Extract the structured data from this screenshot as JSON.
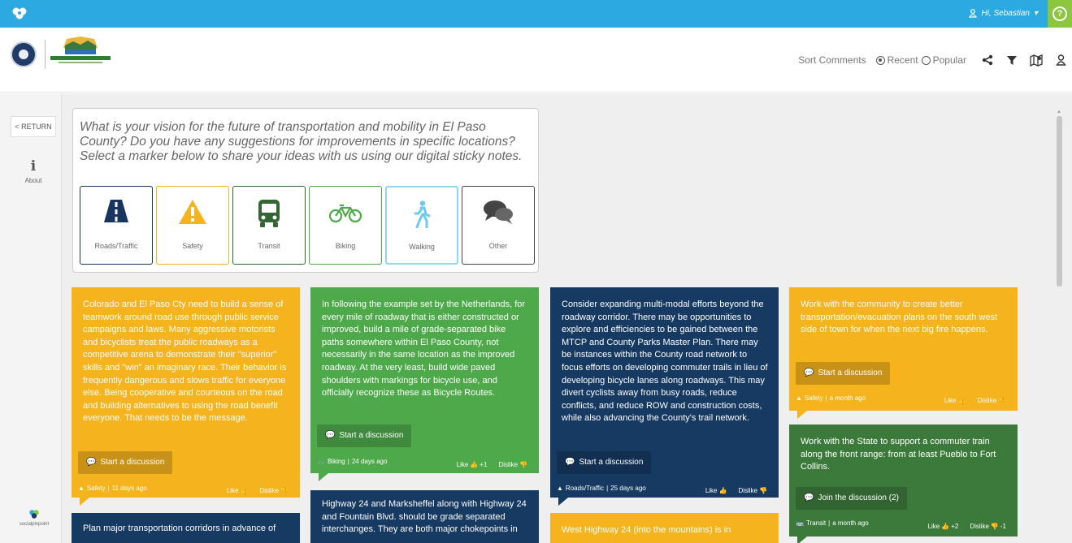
{
  "topbar": {
    "brand_icon": "socialpinpoint-logo-icon",
    "user_label": "Hi, Sebastian",
    "help_label": "?",
    "colors": {
      "bar": "#2ba9e0",
      "help": "#8cc63f"
    }
  },
  "header": {
    "sort_label": "Sort Comments",
    "sort_options": [
      "Recent",
      "Popular"
    ],
    "sort_selected": "Recent",
    "tools": [
      "share-icon",
      "filter-icon",
      "map-icon",
      "user-icon"
    ]
  },
  "sidebar": {
    "return_label": "< RETURN",
    "about_label": "About",
    "brand_label": "socialpinpoint"
  },
  "prompt": {
    "question": "What is your vision for the future of transportation and mobility in El Paso County? Do you have any suggestions for improvements in specific locations? Select a marker below to share your ideas with us using our digital sticky notes.",
    "categories": [
      {
        "label": "Roads/Traffic",
        "icon": "road-icon",
        "color": "#17355e"
      },
      {
        "label": "Safety",
        "icon": "warning-icon",
        "color": "#f5b31e"
      },
      {
        "label": "Transit",
        "icon": "bus-icon",
        "color": "#336633"
      },
      {
        "label": "Biking",
        "icon": "bicycle-icon",
        "color": "#4ea94a"
      },
      {
        "label": "Walking",
        "icon": "pedestrian-icon",
        "color": "#6fc9ea"
      },
      {
        "label": "Other",
        "icon": "speech-bubbles-icon",
        "color": "#444444"
      }
    ]
  },
  "notes": [
    {
      "text": "Colorado and El Paso Cty need to build a sense of teamwork around road use through public service campaigns and laws. Many aggressive motorists and bicyclists treat the public roadways as a competitive arena to demonstrate their \"superior\" skills and \"win\" an imaginary race. Their behavior is frequently dangerous and slows traffic for everyone else. Being cooperative and courteous on the road and building alternatives to using the road benefit everyone. That needs to be the message.",
      "action": "Start a discussion",
      "category": "Safety",
      "age": "11 days ago",
      "like": "Like",
      "dislike": "Dislike"
    },
    {
      "text": "In following the example set by the Netherlands, for every mile of roadway that is either constructed or improved, build a mile of grade-separated bike paths somewhere within El Paso County, not necessarily in the same location as the improved roadway. At the very least, build wide paved shoulders with markings for bicycle use, and officially recognize these as Bicycle Routes.",
      "action": "Start a discussion",
      "category": "Biking",
      "age": "24 days ago",
      "like": "Like",
      "like_count": "+1",
      "dislike": "Dislike"
    },
    {
      "text": "Consider expanding multi-modal efforts beyond the roadway corridor. There may be opportunities to explore and efficiencies to be gained between the MTCP and County Parks Master Plan. There may be instances within the County road network to focus efforts on developing commuter trails in lieu of developing bicycle lanes along roadways. This may divert cyclists away from busy roads, reduce conflicts, and reduce ROW and construction costs, while also advancing the County's trail network.",
      "action": "Start a discussion",
      "category": "Roads/Traffic",
      "age": "25 days ago",
      "like": "Like",
      "dislike": "Dislike"
    },
    {
      "text": "Work with the community to create better transportation/evacuation plans on the south west side of town for when the next big fire happens.",
      "action": "Start a discussion",
      "category": "Safety",
      "age": "a month ago",
      "like": "Like",
      "dislike": "Dislike"
    },
    {
      "text": "Work with the State to support a commuter train along the front range: from at least Pueblo to Fort Collins.",
      "action": "Join the discussion (2)",
      "category": "Transit",
      "age": "a month ago",
      "like": "Like",
      "like_count": "+2",
      "dislike": "Dislike",
      "dislike_count": "-1"
    },
    {
      "text": "Plan major transportation corridors in advance of"
    },
    {
      "text": "Highway 24 and Marksheffel along with Highway 24 and Fountain Blvd. should be grade separated interchanges. They are both major chokepoints in"
    },
    {
      "text": "West Highway 24 (into the mountains) is in"
    }
  ],
  "colors": {
    "yellow": "#f5b31e",
    "green": "#4ea94a",
    "navy": "#173a63",
    "dark_green": "#3c7a3c"
  }
}
